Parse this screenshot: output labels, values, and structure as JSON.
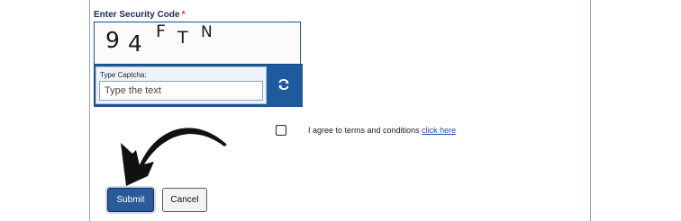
{
  "security_code": {
    "label": "Enter Security Code",
    "required_marker": "*",
    "captcha_chars": [
      "9",
      "4",
      "F",
      "T",
      "N"
    ]
  },
  "captcha_entry": {
    "label": "Type Captcha:",
    "placeholder": "Type the text",
    "value": ""
  },
  "refresh": {
    "icon": "refresh-icon"
  },
  "terms": {
    "text": "I agree to terms and conditions",
    "link_text": "click here",
    "checked": false
  },
  "buttons": {
    "submit_label": "Submit",
    "cancel_label": "Cancel"
  },
  "colors": {
    "accent": "#1d5b9e",
    "submit_bg": "#2a5a99",
    "link": "#1f4aa8",
    "required": "#d0312d"
  }
}
